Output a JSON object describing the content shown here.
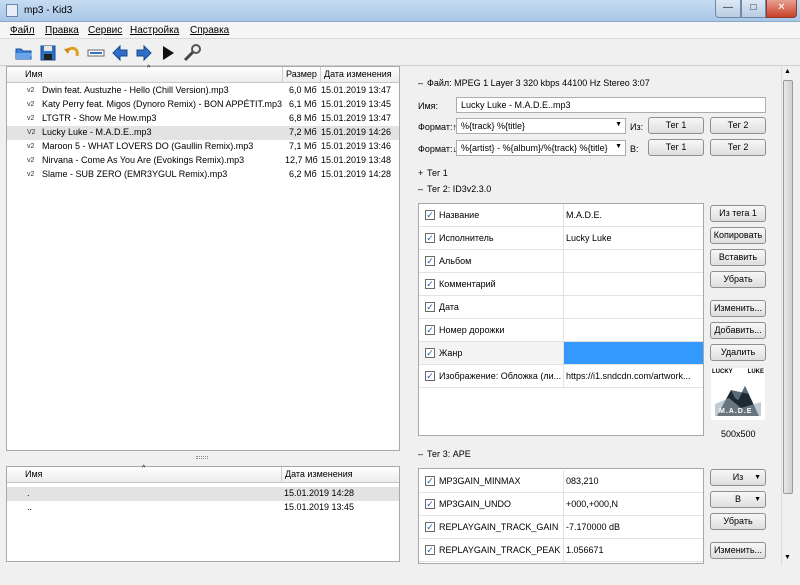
{
  "window": {
    "title": "mp3 - Kid3",
    "min": "—",
    "max": "□",
    "close": "✕"
  },
  "menu": [
    "Файл",
    "Правка",
    "Сервис",
    "Настройка",
    "Справка"
  ],
  "file_list": {
    "headers": {
      "name": "Имя",
      "size": "Размер",
      "date": "Дата изменения"
    },
    "rows": [
      {
        "tag": "v2",
        "name": "Dwin feat. Austuzhe - Hello (Chill Version).mp3",
        "size": "6,0 Мб",
        "date": "15.01.2019 13:47"
      },
      {
        "tag": "v2",
        "name": "Katy Perry feat. Migos (Dynoro Remix) - BON APPÉTIT.mp3",
        "size": "6,1 Мб",
        "date": "15.01.2019 13:45"
      },
      {
        "tag": "v2",
        "name": "LTGTR - Show Me How.mp3",
        "size": "6,8 Мб",
        "date": "15.01.2019 13:47"
      },
      {
        "tag": "V2",
        "name": "Lucky Luke - M.A.D.E..mp3",
        "size": "7,2 Мб",
        "date": "15.01.2019 14:26"
      },
      {
        "tag": "v2",
        "name": "Maroon 5 - WHAT LOVERS DO (Gaullin Remix).mp3",
        "size": "7,1 Мб",
        "date": "15.01.2019 13:46"
      },
      {
        "tag": "v2",
        "name": "Nirvana - Come As You Are (Evokings Remix).mp3",
        "size": "12,7 Мб",
        "date": "15.01.2019 13:48"
      },
      {
        "tag": "v2",
        "name": "Slame - SUB ZERO (EMR3YGUL Remix).mp3",
        "size": "6,2 Мб",
        "date": "15.01.2019 14:28"
      }
    ]
  },
  "dir_list": {
    "headers": {
      "name": "Имя",
      "date": "Дата изменения"
    },
    "rows": [
      {
        "name": ".",
        "date": "15.01.2019 14:28"
      },
      {
        "name": "..",
        "date": "15.01.2019 13:45"
      }
    ]
  },
  "file_info": {
    "section": "Файл: MPEG 1 Layer 3 320 kbps 44100 Hz Stereo 3:07",
    "name_label": "Имя:",
    "name_value": "Lucky Luke - M.A.D.E..mp3",
    "format_from_label": "Формат:↑",
    "format_from_value": "%{track} %{title}",
    "from_label": "Из:",
    "format_to_label": "Формат:↓",
    "format_to_value": "%{artist} - %{album}/%{track} %{title}",
    "to_label": "В:",
    "tag1_btn": "Тег 1",
    "tag2_btn": "Тег 2"
  },
  "tag1": {
    "header": "Тег 1"
  },
  "tag2": {
    "header": "Тег 2: ID3v2.3.0",
    "rows": [
      {
        "name": "Название",
        "value": "M.A.D.E."
      },
      {
        "name": "Исполнитель",
        "value": "Lucky Luke"
      },
      {
        "name": "Альбом",
        "value": ""
      },
      {
        "name": "Комментарий",
        "value": ""
      },
      {
        "name": "Дата",
        "value": ""
      },
      {
        "name": "Номер дорожки",
        "value": ""
      },
      {
        "name": "Жанр",
        "value": ""
      },
      {
        "name": "Изображение: Обложка (ли...",
        "value": "https://i1.sndcdn.com/artwork..."
      }
    ],
    "buttons": [
      "Из тега 1",
      "Копировать",
      "Вставить",
      "Убрать",
      "Изменить...",
      "Добавить...",
      "Удалить"
    ],
    "cover_text": {
      "left": "LUCKY",
      "right": "LUKE",
      "bottom": "M.A.D.E"
    },
    "cover_size": "500x500"
  },
  "tag3": {
    "header": "Тег 3: APE",
    "rows": [
      {
        "name": "MP3GAIN_MINMAX",
        "value": "083,210"
      },
      {
        "name": "MP3GAIN_UNDO",
        "value": "+000,+000,N"
      },
      {
        "name": "REPLAYGAIN_TRACK_GAIN",
        "value": "-7.170000 dB"
      },
      {
        "name": "REPLAYGAIN_TRACK_PEAK",
        "value": "1.056671"
      }
    ],
    "buttons": [
      "Из",
      "В",
      "Убрать",
      "Изменить..."
    ]
  },
  "colors": {
    "selection": "#3399ff",
    "titlebar": "#b7d0ec"
  }
}
